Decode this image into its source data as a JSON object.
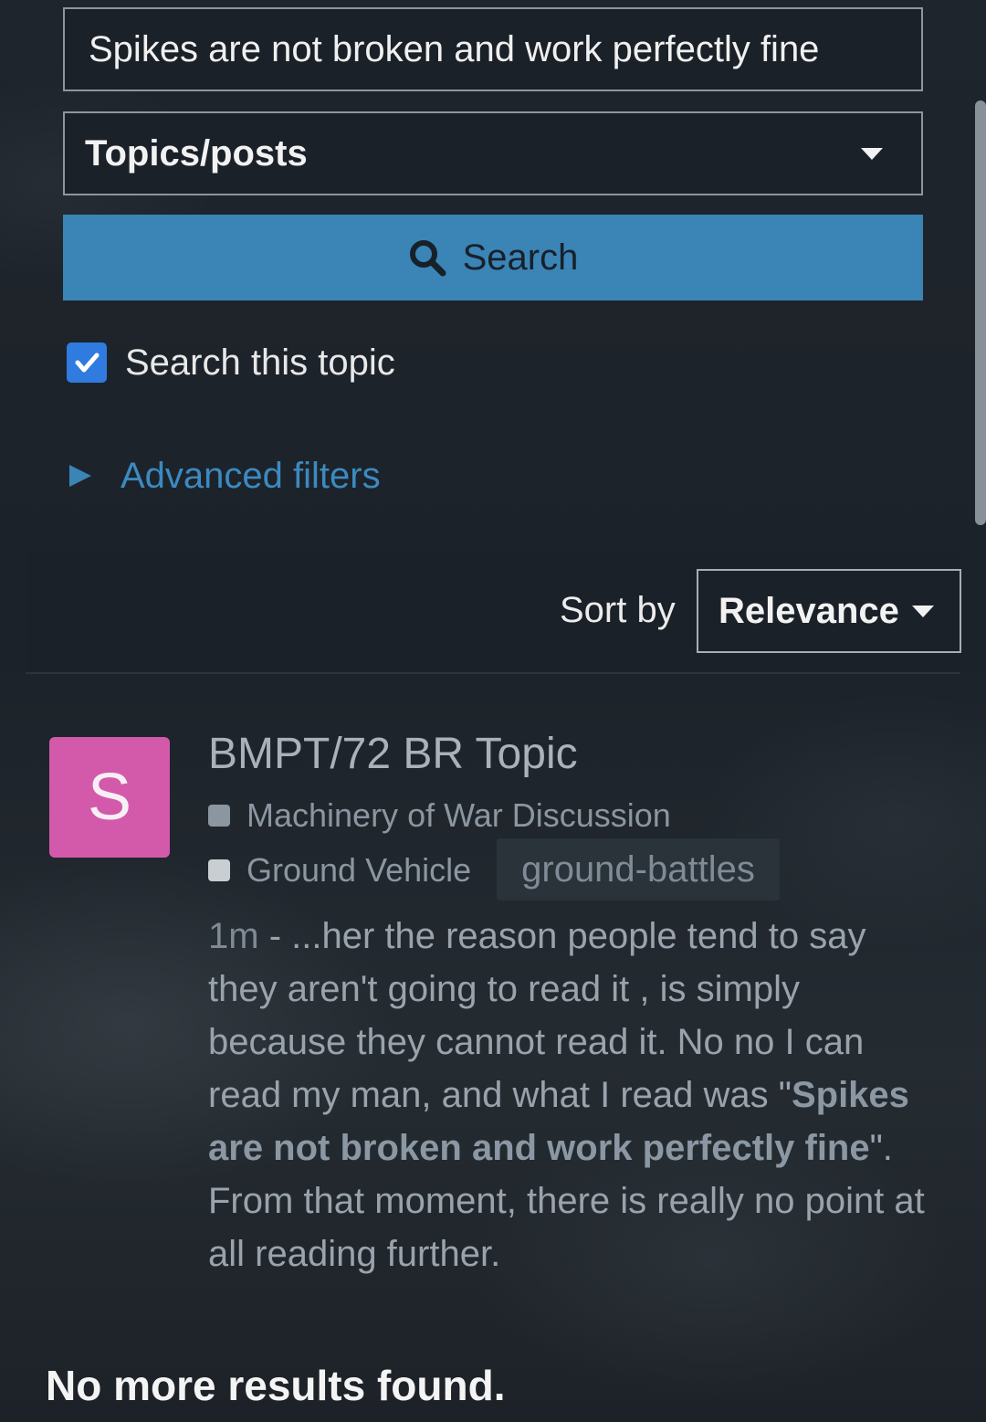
{
  "search": {
    "query": "Spikes are not broken and work perfectly fine",
    "type_label": "Topics/posts",
    "button_label": "Search",
    "this_topic_label": "Search this topic",
    "this_topic_checked": true,
    "advanced_label": "Advanced filters"
  },
  "sort": {
    "label": "Sort by",
    "value": "Relevance"
  },
  "result": {
    "avatar_letter": "S",
    "avatar_color": "#d35aab",
    "title": "BMPT/72 BR Topic",
    "category": "Machinery of War Discussion",
    "category_color": "#8c96a0",
    "subcategory": "Ground Vehicle",
    "subcategory_color": "#c9ced3",
    "tag": "ground-battles",
    "date": "1m",
    "excerpt_before": " - ...her the reason people tend to say they aren't going to read it , is simply because they cannot read it. No no I can read my man, and what I read was \"",
    "excerpt_highlight": "Spikes are not broken and work perfectly fine",
    "excerpt_after": "\". From that moment, there is really no point at all reading further."
  },
  "footer": {
    "no_more": "No more results found."
  },
  "colors": {
    "accent": "#3b84b6",
    "checkbox": "#2f7be0",
    "background": "#1b2128"
  }
}
